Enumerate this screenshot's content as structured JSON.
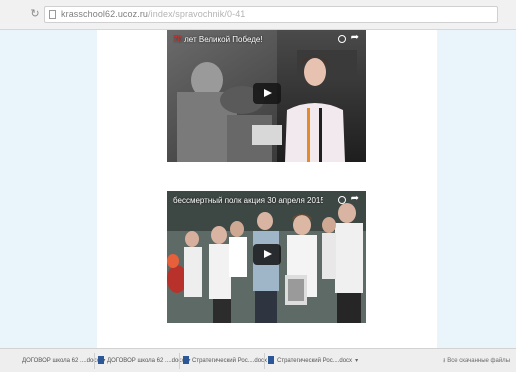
{
  "browser": {
    "url_host": "krasschool62.ucoz.ru",
    "url_path": "/index/spravochnik/0-41"
  },
  "videos": [
    {
      "title": "70 лет Великой Победе!",
      "title_highlight": "70",
      "title_rest": " лет Великой Победе!"
    },
    {
      "title": "бессмертный полк акция 30 апреля 2015"
    }
  ],
  "download_bar": {
    "items": [
      {
        "label": "ДОГОВОР школа 62 ....docx"
      },
      {
        "label": "ДОГОВОР школа 62 ....docx"
      },
      {
        "label": "Стратегический Рос....docx"
      },
      {
        "label": "Стратегический Рос....docx"
      }
    ],
    "show_all_label": "Все скачанные файлы"
  },
  "icons": {
    "reload": "reload-icon",
    "page": "page-icon",
    "watch_later": "clock-icon",
    "share": "share-icon",
    "play": "play-icon",
    "file": "word-file-icon",
    "download": "download-icon"
  },
  "colors": {
    "page_bg": "#e9f4fb",
    "content_bg": "#ffffff",
    "title_accent": "#e0302a",
    "file_icon": "#2b5797"
  }
}
